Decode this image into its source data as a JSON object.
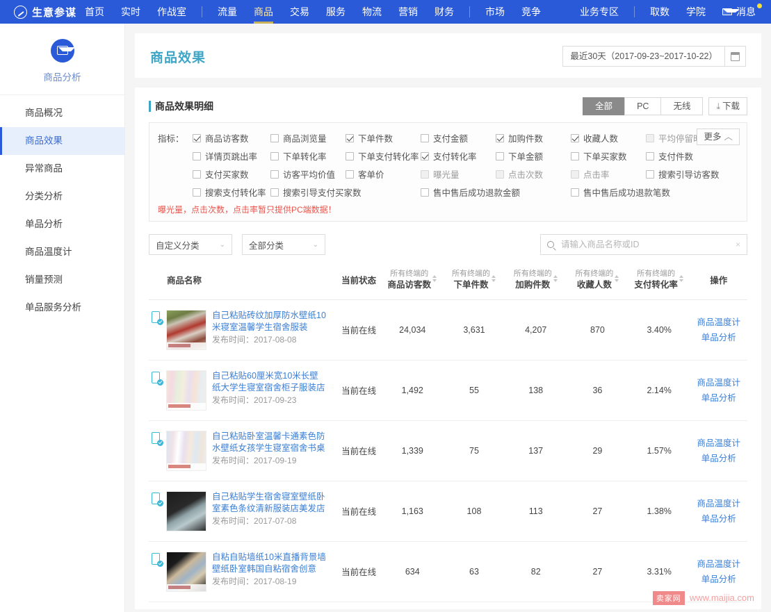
{
  "topnav": {
    "brand": "生意参谋",
    "left_items": [
      "首页",
      "实时",
      "作战室"
    ],
    "group2": [
      "流量",
      "商品",
      "交易",
      "服务",
      "物流",
      "营销",
      "财务"
    ],
    "group3": [
      "市场",
      "竞争"
    ],
    "group4": [
      "业务专区"
    ],
    "group5": [
      "取数",
      "学院"
    ],
    "active": "商品",
    "message_label": "消息"
  },
  "sidebar": {
    "header": "商品分析",
    "items": [
      {
        "label": "商品概况",
        "active": false
      },
      {
        "label": "商品效果",
        "active": true
      },
      {
        "label": "异常商品",
        "active": false
      },
      {
        "label": "分类分析",
        "active": false
      },
      {
        "label": "单品分析",
        "active": false
      },
      {
        "label": "商品温度计",
        "active": false
      },
      {
        "label": "销量预测",
        "active": false
      },
      {
        "label": "单品服务分析",
        "active": false
      }
    ]
  },
  "header": {
    "title": "商品效果",
    "date_range": "最近30天（2017-09-23~2017-10-22）"
  },
  "card": {
    "title": "商品效果明细",
    "segments": [
      {
        "label": "全部",
        "active": true
      },
      {
        "label": "PC",
        "active": false
      },
      {
        "label": "无线",
        "active": false
      }
    ],
    "download_label": "下载"
  },
  "metrics": {
    "label": "指标：",
    "more_label": "更多",
    "notice": "曝光量，点击次数，点击率暂只提供PC端数据！",
    "rows": [
      [
        {
          "label": "商品访客数",
          "checked": true,
          "disabled": false
        },
        {
          "label": "商品浏览量",
          "checked": false,
          "disabled": false
        },
        {
          "label": "下单件数",
          "checked": true,
          "disabled": false
        },
        {
          "label": "支付金额",
          "checked": false,
          "disabled": false
        },
        {
          "label": "加购件数",
          "checked": true,
          "disabled": false
        },
        {
          "label": "收藏人数",
          "checked": true,
          "disabled": false
        },
        {
          "label": "平均停留时长",
          "checked": false,
          "disabled": true
        }
      ],
      [
        {
          "label": "详情页跳出率",
          "checked": false,
          "disabled": false
        },
        {
          "label": "下单转化率",
          "checked": false,
          "disabled": false
        },
        {
          "label": "下单支付转化率",
          "checked": false,
          "disabled": false
        },
        {
          "label": "支付转化率",
          "checked": true,
          "disabled": false
        },
        {
          "label": "下单金额",
          "checked": false,
          "disabled": false
        },
        {
          "label": "下单买家数",
          "checked": false,
          "disabled": false
        },
        {
          "label": "支付件数",
          "checked": false,
          "disabled": false
        }
      ],
      [
        {
          "label": "支付买家数",
          "checked": false,
          "disabled": false
        },
        {
          "label": "访客平均价值",
          "checked": false,
          "disabled": false
        },
        {
          "label": "客单价",
          "checked": false,
          "disabled": false
        },
        {
          "label": "曝光量",
          "checked": false,
          "disabled": true
        },
        {
          "label": "点击次数",
          "checked": false,
          "disabled": true
        },
        {
          "label": "点击率",
          "checked": false,
          "disabled": true
        },
        {
          "label": "搜索引导访客数",
          "checked": false,
          "disabled": false
        }
      ],
      [
        {
          "label": "搜索支付转化率",
          "checked": false,
          "disabled": false
        },
        {
          "label": "搜索引导支付买家数",
          "checked": false,
          "disabled": false
        },
        {
          "label": "售中售后成功退款金额",
          "checked": false,
          "disabled": false
        },
        {
          "label": "售中售后成功退款笔数",
          "checked": false,
          "disabled": false
        }
      ]
    ]
  },
  "filters": {
    "custom_category": "自定义分类",
    "all_category": "全部分类",
    "search_placeholder": "请输入商品名称或ID",
    "search_value": ""
  },
  "table": {
    "columns": [
      {
        "main": "商品名称",
        "sub": "",
        "sortable": false
      },
      {
        "main": "当前状态",
        "sub": "",
        "sortable": false
      },
      {
        "main": "商品访客数",
        "sub": "所有终端的",
        "sortable": true
      },
      {
        "main": "下单件数",
        "sub": "所有终端的",
        "sortable": true
      },
      {
        "main": "加购件数",
        "sub": "所有终端的",
        "sortable": true
      },
      {
        "main": "收藏人数",
        "sub": "所有终端的",
        "sortable": true
      },
      {
        "main": "支付转化率",
        "sub": "所有终端的",
        "sortable": true
      },
      {
        "main": "操作",
        "sub": "",
        "sortable": false
      }
    ],
    "time_prefix": "发布时间：",
    "op_links": [
      "商品温度计",
      "单品分析"
    ],
    "rows": [
      {
        "name": "自己粘贴砖纹加厚防水壁纸10米寝室温馨学生宿舍服装",
        "publish_time": "2017-08-08",
        "status": "当前在线",
        "visitors": "24,034",
        "orders": "3,631",
        "cart": "4,207",
        "favorites": "870",
        "pay_rate": "3.40%",
        "thumb": "tb1"
      },
      {
        "name": "自己粘贴60厘米宽10米长壁纸大学生寝室宿舍柜子服装店",
        "publish_time": "2017-09-23",
        "status": "当前在线",
        "visitors": "1,492",
        "orders": "55",
        "cart": "138",
        "favorites": "36",
        "pay_rate": "2.14%",
        "thumb": "tb2"
      },
      {
        "name": "自己粘贴卧室温馨卡通素色防水壁纸女孩学生寝室宿舍书桌",
        "publish_time": "2017-09-19",
        "status": "当前在线",
        "visitors": "1,339",
        "orders": "75",
        "cart": "137",
        "favorites": "29",
        "pay_rate": "1.57%",
        "thumb": "tb3"
      },
      {
        "name": "自己粘贴学生宿舍寝室壁纸卧室素色条纹清新服装店美发店",
        "publish_time": "2017-07-08",
        "status": "当前在线",
        "visitors": "1,163",
        "orders": "108",
        "cart": "113",
        "favorites": "27",
        "pay_rate": "1.38%",
        "thumb": "tb4"
      },
      {
        "name": "自粘自贴墙纸10米直播背景墙壁纸卧室韩国自粘宿舍创意",
        "publish_time": "2017-08-19",
        "status": "当前在线",
        "visitors": "634",
        "orders": "63",
        "cart": "82",
        "favorites": "27",
        "pay_rate": "3.31%",
        "thumb": "tb5"
      }
    ]
  },
  "watermark": {
    "badge": "卖家网",
    "url": "www.maijia.com"
  }
}
